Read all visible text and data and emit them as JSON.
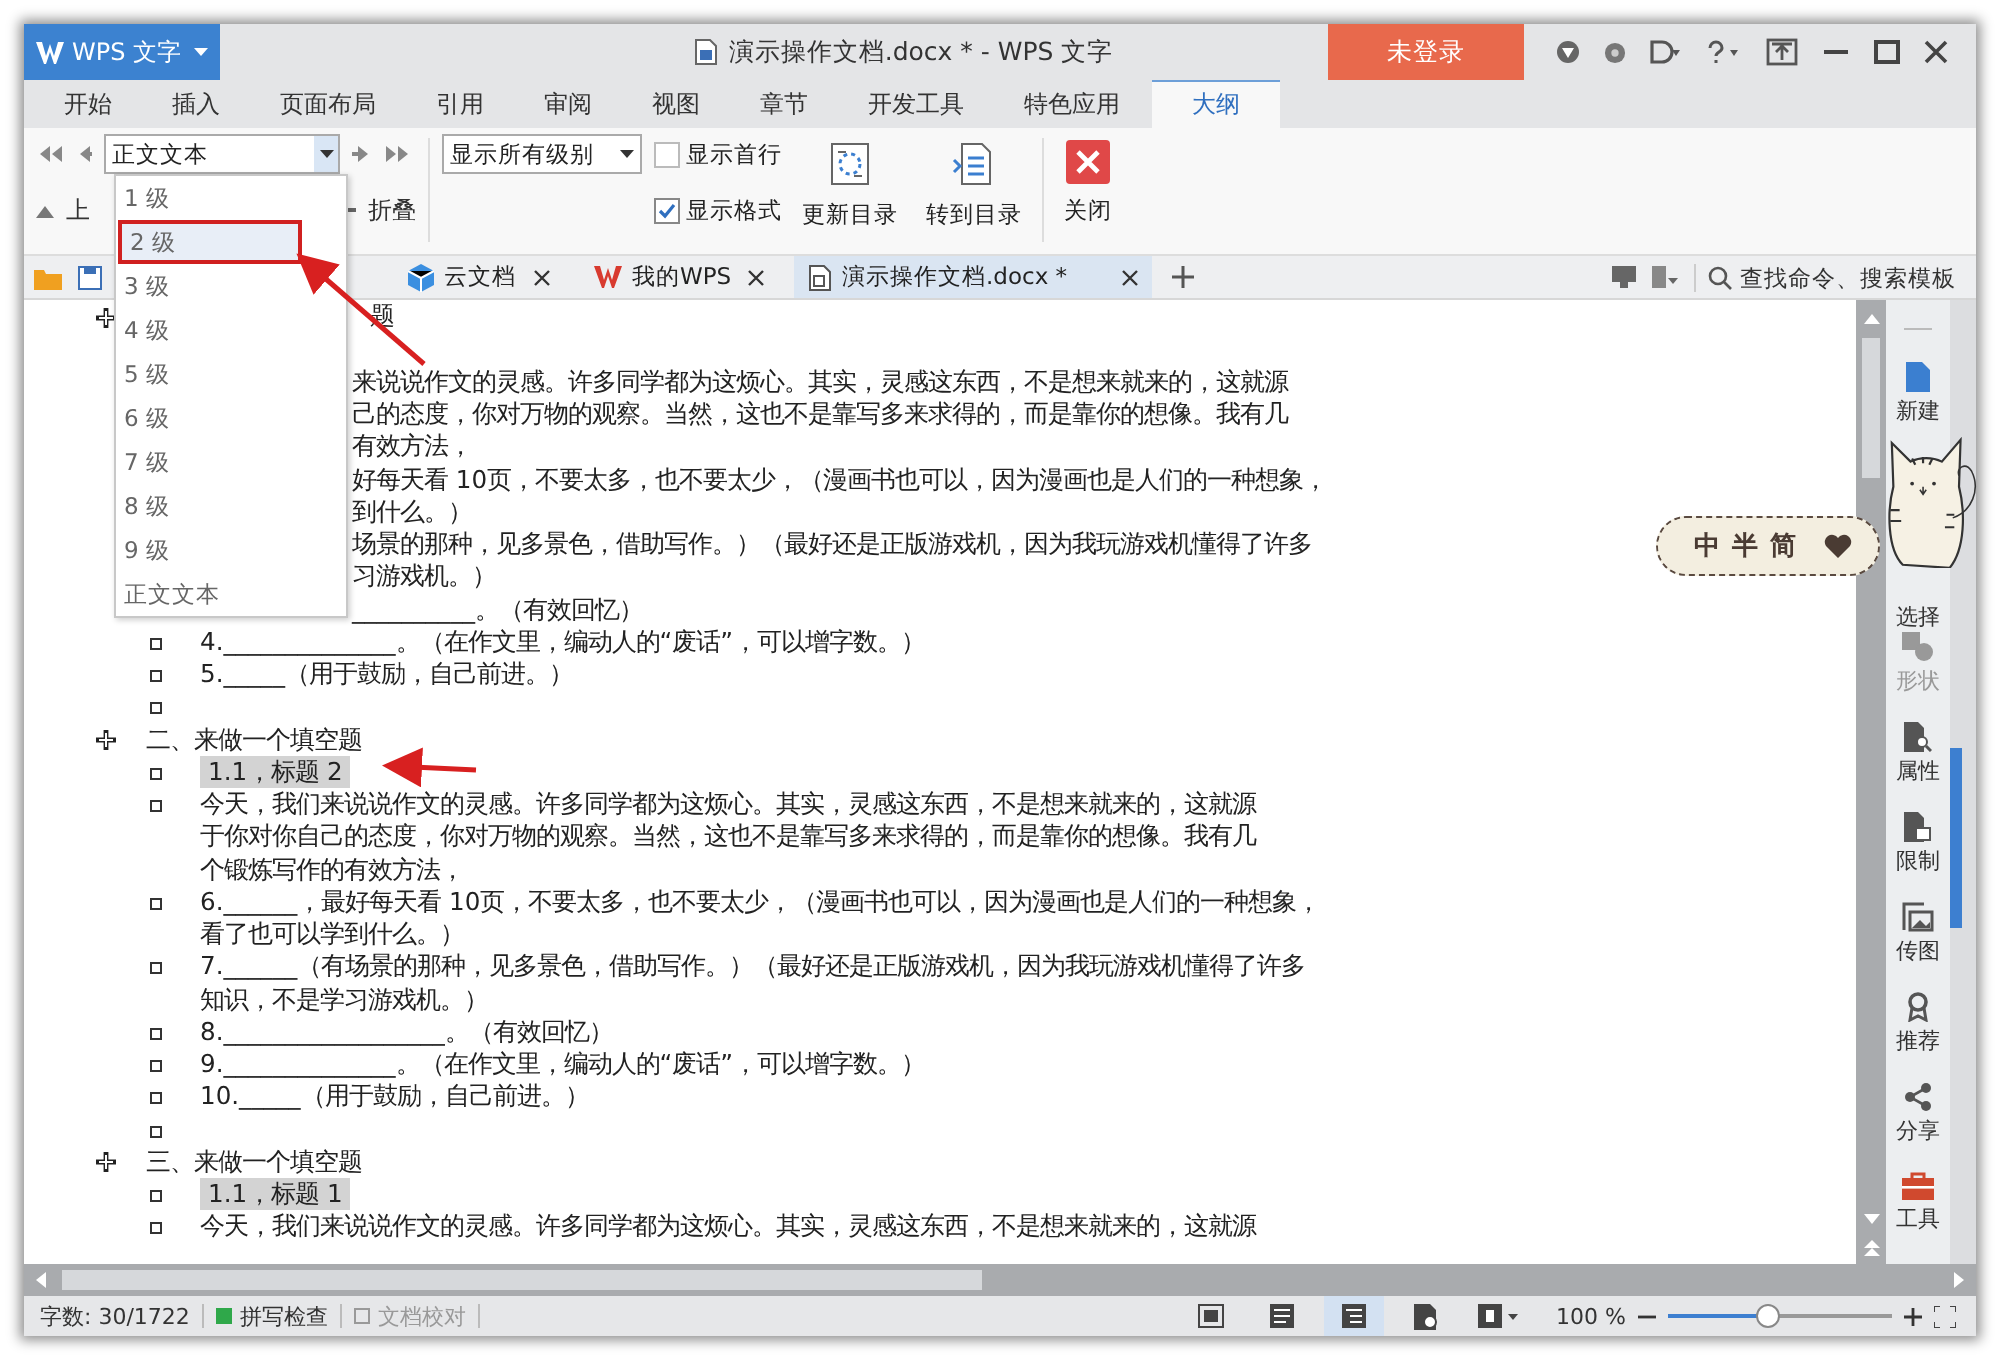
{
  "app_button": {
    "label": "WPS 文字"
  },
  "window": {
    "title": "演示操作文档.docx * - WPS 文字"
  },
  "login_button": {
    "label": "未登录"
  },
  "menu_tabs": [
    {
      "label": "开始",
      "selected": false
    },
    {
      "label": "插入",
      "selected": false
    },
    {
      "label": "页面布局",
      "selected": false
    },
    {
      "label": "引用",
      "selected": false
    },
    {
      "label": "审阅",
      "selected": false
    },
    {
      "label": "视图",
      "selected": false
    },
    {
      "label": "章节",
      "selected": false
    },
    {
      "label": "开发工具",
      "selected": false
    },
    {
      "label": "特色应用",
      "selected": false
    },
    {
      "label": "大纲",
      "selected": true
    }
  ],
  "ribbon": {
    "level_combo": {
      "value": "正文文本"
    },
    "move_up": "上",
    "collapse": "折叠",
    "show_combo": {
      "value": "显示所有级别"
    },
    "checkboxes": [
      {
        "label": "显示首行",
        "checked": false
      },
      {
        "label": "显示格式",
        "checked": true
      }
    ],
    "buttons": [
      {
        "label": "更新目录",
        "kind": "update"
      },
      {
        "label": "转到目录",
        "kind": "goto"
      },
      {
        "label": "关闭",
        "kind": "close"
      }
    ]
  },
  "level_menu": [
    {
      "label": "1 级",
      "selected": false
    },
    {
      "label": "2 级",
      "selected": true
    },
    {
      "label": "3 级",
      "selected": false
    },
    {
      "label": "4 级",
      "selected": false
    },
    {
      "label": "5 级",
      "selected": false
    },
    {
      "label": "6 级",
      "selected": false
    },
    {
      "label": "7 级",
      "selected": false
    },
    {
      "label": "8 级",
      "selected": false
    },
    {
      "label": "9 级",
      "selected": false
    },
    {
      "label": "正文文本",
      "selected": false
    }
  ],
  "doc_tabs": [
    {
      "label": "云文档",
      "kind": "cloud",
      "selected": false
    },
    {
      "label": "我的WPS",
      "kind": "wps",
      "selected": false
    },
    {
      "label": "演示操作文档.docx *",
      "kind": "doc",
      "selected": true
    }
  ],
  "search": {
    "placeholder": "查找命令、搜索模板"
  },
  "outline": [
    {
      "heading": "题",
      "covered": true,
      "items": [
        {
          "covered": true,
          "highlighted": false,
          "lines": [
            "来说说作文的灵感。许多同学都为这烦心。其实，灵感这东西，不是想来就来的，这就源",
            "己的态度，你对万物的观察。当然，这也不是靠写多来求得的，而是靠你的想像。我有几",
            "有效方法，"
          ]
        },
        {
          "covered": true,
          "highlighted": false,
          "lines": [
            "好每天看 10页，不要太多，也不要太少，（漫画书也可以，因为漫画也是人们的一种想象，",
            "到什么。）"
          ]
        },
        {
          "covered": true,
          "highlighted": false,
          "lines": [
            "场景的那种，见多景色，借助写作。）（最好还是正版游戏机，因为我玩游戏机懂得了许多",
            "习游戏机。）"
          ]
        },
        {
          "covered": true,
          "highlighted": false,
          "lines": [
            "__________。（有效回忆）"
          ]
        },
        {
          "covered": false,
          "highlighted": false,
          "lines": [
            "4.______________。（在作文里，编动人的“废话”，可以增字数。）"
          ]
        },
        {
          "covered": false,
          "highlighted": false,
          "lines": [
            "5._____（用于鼓励，自己前进。）"
          ]
        },
        {
          "covered": false
        }
      ]
    },
    {
      "heading": "二、来做一个填空题",
      "covered": false,
      "items": [
        {
          "covered": false,
          "highlighted": true,
          "lines": [
            "1.1，标题 2"
          ]
        },
        {
          "covered": false,
          "highlighted": false,
          "lines": [
            "今天，我们来说说作文的灵感。许多同学都为这烦心。其实，灵感这东西，不是想来就来的，这就源",
            "于你对你自己的态度，你对万物的观察。当然，这也不是靠写多来求得的，而是靠你的想像。我有几",
            "个锻炼写作的有效方法，"
          ]
        },
        {
          "covered": false,
          "highlighted": false,
          "lines": [
            "6.______，最好每天看 10页，不要太多，也不要太少，（漫画书也可以，因为漫画也是人们的一种想象，",
            "看了也可以学到什么。）"
          ]
        },
        {
          "covered": false,
          "highlighted": false,
          "lines": [
            "7.______（有场景的那种，见多景色，借助写作。）（最好还是正版游戏机，因为我玩游戏机懂得了许多",
            "知识，不是学习游戏机。）"
          ]
        },
        {
          "covered": false,
          "highlighted": false,
          "lines": [
            "8.__________________。（有效回忆）"
          ]
        },
        {
          "covered": false,
          "highlighted": false,
          "lines": [
            "9.______________。（在作文里，编动人的“废话”，可以增字数。）"
          ]
        },
        {
          "covered": false,
          "highlighted": false,
          "lines": [
            "10._____（用于鼓励，自己前进。）"
          ]
        },
        {
          "covered": false
        }
      ]
    },
    {
      "heading": "三、来做一个填空题",
      "covered": false,
      "items": [
        {
          "covered": false,
          "highlighted": true,
          "lines": [
            "1.1，标题 1"
          ]
        },
        {
          "covered": false,
          "highlighted": false,
          "lines": [
            "今天，我们来说说作文的灵感。许多同学都为这烦心。其实，灵感这东西，不是想来就来的，这就源"
          ]
        }
      ]
    }
  ],
  "side_panel": [
    {
      "label": "新建",
      "kind": "new",
      "disabled": false
    },
    {
      "label": "选择",
      "kind": "select",
      "disabled": false
    },
    {
      "label": "形状",
      "kind": "shape",
      "disabled": true
    },
    {
      "label": "属性",
      "kind": "property",
      "disabled": false
    },
    {
      "label": "限制",
      "kind": "restrict",
      "disabled": false
    },
    {
      "label": "传图",
      "kind": "image",
      "disabled": false
    },
    {
      "label": "推荐",
      "kind": "recommend",
      "disabled": false
    },
    {
      "label": "分享",
      "kind": "share",
      "disabled": false
    },
    {
      "label": "工具",
      "kind": "tools",
      "disabled": false
    }
  ],
  "sticker": {
    "text": "中半简"
  },
  "status_bar": {
    "word_count": "字数: 30/1722",
    "spell_check": {
      "label": "拼写检查",
      "on": true
    },
    "proofread": {
      "label": "文档校对",
      "on": false
    },
    "views": [
      {
        "kind": "fit",
        "selected": false
      },
      {
        "kind": "page",
        "selected": false
      },
      {
        "kind": "outline",
        "selected": true
      },
      {
        "kind": "web",
        "selected": false
      },
      {
        "kind": "reading",
        "selected": false
      }
    ],
    "zoom": {
      "reading": "100 %",
      "level": 0.45
    }
  }
}
